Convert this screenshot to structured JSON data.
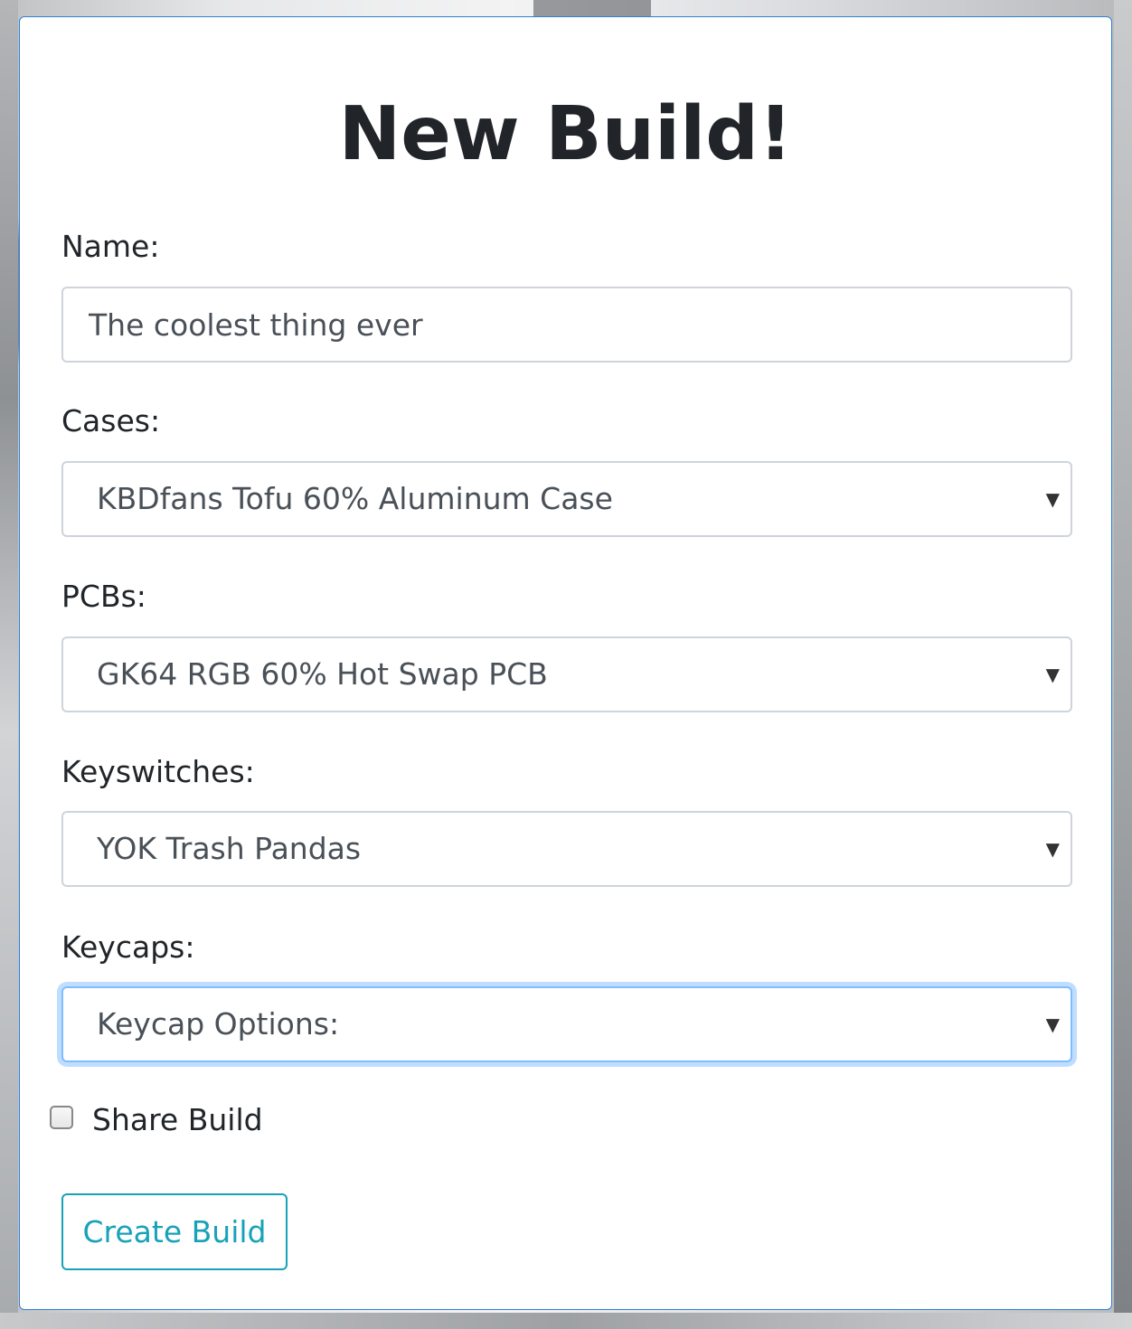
{
  "page": {
    "title": "New Build!"
  },
  "form": {
    "name": {
      "label": "Name:",
      "value": "The coolest thing ever"
    },
    "cases": {
      "label": "Cases:",
      "selected": "KBDfans Tofu 60% Aluminum Case"
    },
    "pcbs": {
      "label": "PCBs:",
      "selected": "GK64 RGB 60% Hot Swap PCB"
    },
    "keyswitches": {
      "label": "Keyswitches:",
      "selected": "YOK Trash Pandas"
    },
    "keycaps": {
      "label": "Keycaps:",
      "selected": "Keycap Options:"
    },
    "share": {
      "label": "Share Build",
      "checked": false
    },
    "submit_label": "Create Build"
  },
  "icons": {
    "dropdown": "caret-down-icon",
    "caret_glyph": "▼"
  },
  "colors": {
    "card_border": "#2f7fd3",
    "focus_ring": "#80bdff",
    "button_accent": "#17a2b8",
    "text": "#212529"
  }
}
